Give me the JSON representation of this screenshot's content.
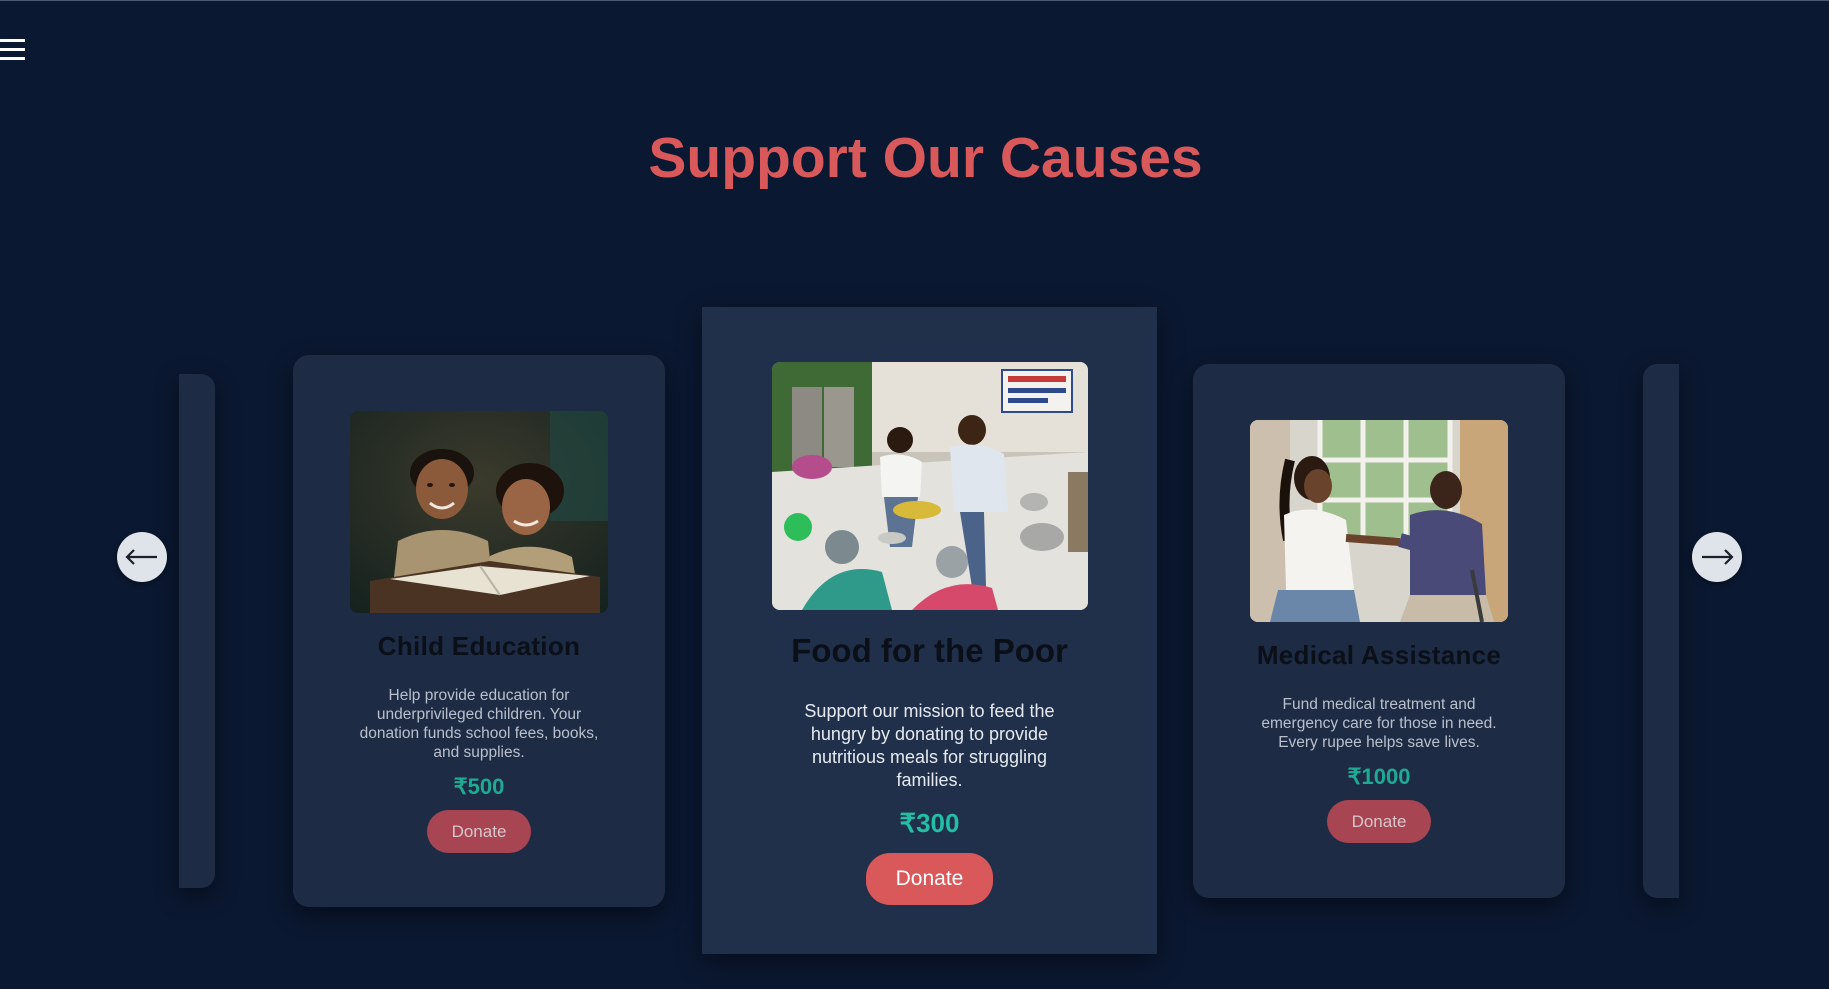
{
  "header": {
    "menu_icon": "hamburger-menu-icon",
    "title": "Support Our Causes"
  },
  "colors": {
    "background": "#0b1831",
    "card": "#1e2b45",
    "accent": "#d9585a",
    "amount": "#1faa93"
  },
  "carousel": {
    "prev_icon": "arrow-left-icon",
    "next_icon": "arrow-right-icon",
    "cards": [
      {
        "title": "Child Education",
        "description": "Help provide education for underprivileged children. Your donation funds school fees, books, and supplies.",
        "amount": "₹500",
        "button": "Donate",
        "image": "children-studying-photo"
      },
      {
        "title": "Food for the Poor",
        "description": "Support our mission to feed the hungry by donating to provide nutritious meals for struggling families.",
        "amount": "₹300",
        "button": "Donate",
        "image": "food-distribution-photo"
      },
      {
        "title": "Medical Assistance",
        "description": "Fund medical treatment and emergency care for those in need. Every rupee helps save lives.",
        "amount": "₹1000",
        "button": "Donate",
        "image": "medical-checkup-photo"
      }
    ]
  }
}
